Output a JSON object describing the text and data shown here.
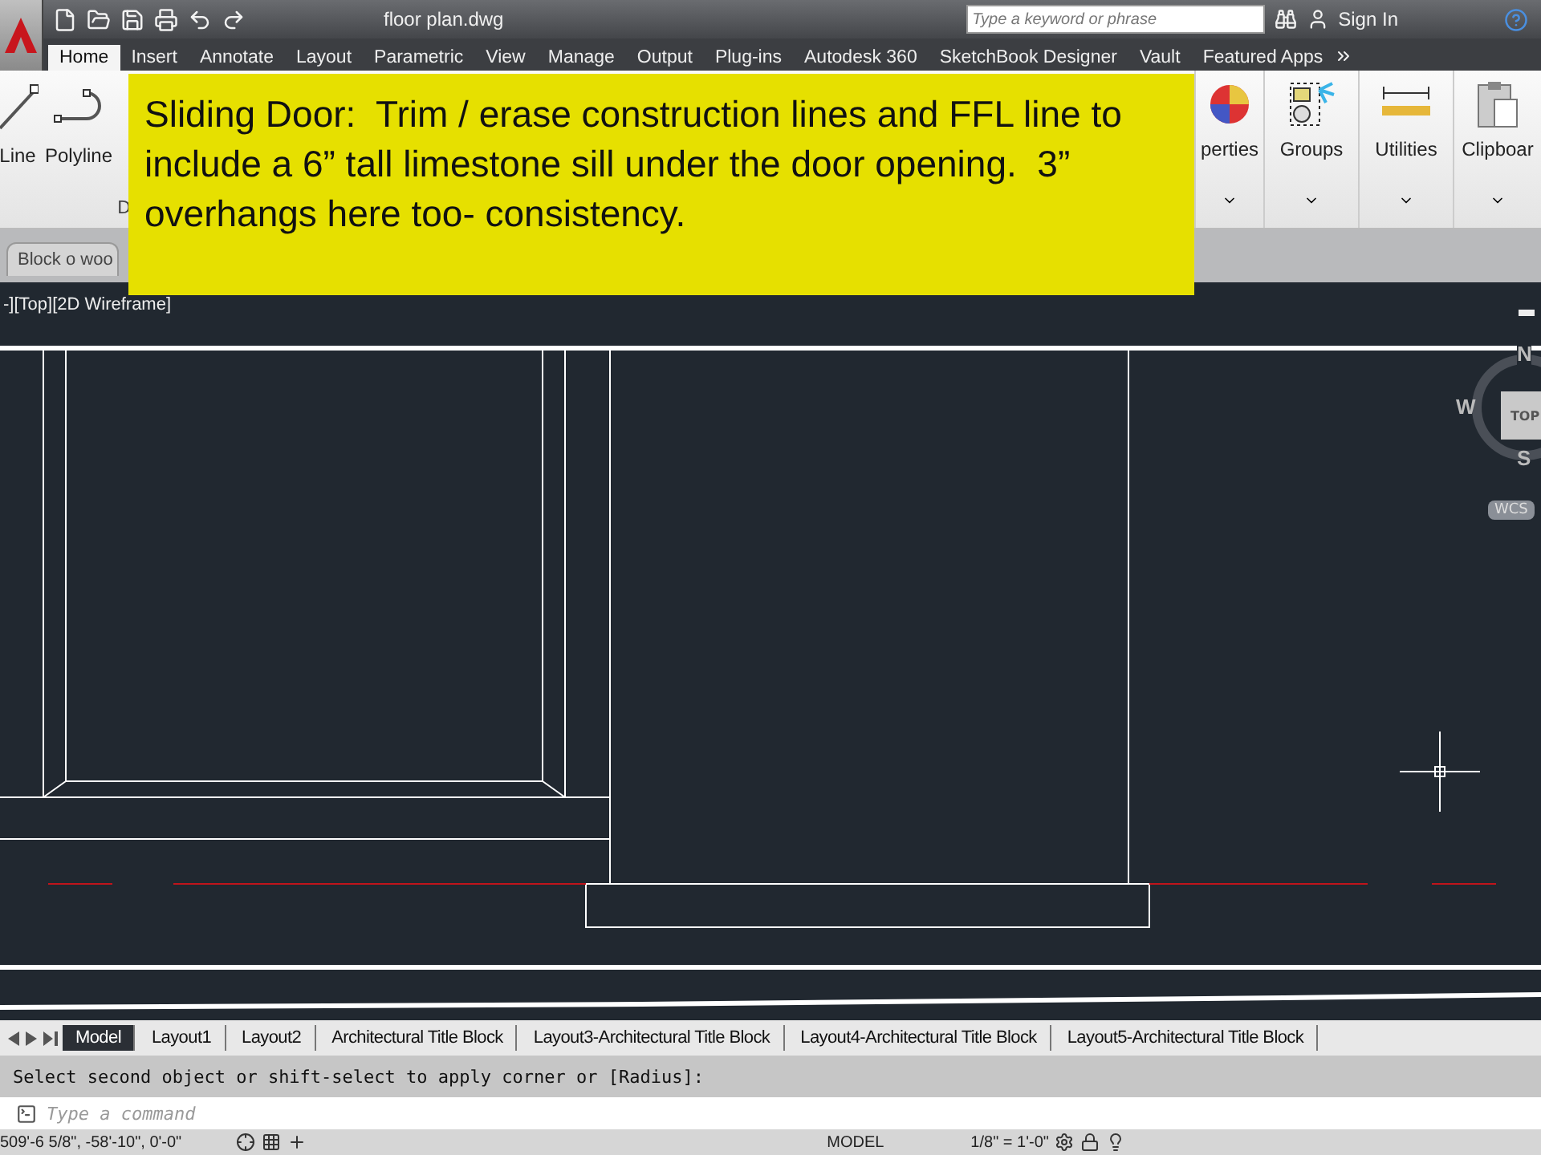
{
  "title_bar": {
    "title": "floor plan.dwg",
    "search": {
      "placeholder": "Type a keyword or phrase"
    },
    "sign_in": "Sign In"
  },
  "ribbon_tabs": [
    {
      "label": "Home",
      "selected": true
    },
    {
      "label": "Insert",
      "selected": false
    },
    {
      "label": "Annotate",
      "selected": false
    },
    {
      "label": "Layout",
      "selected": false
    },
    {
      "label": "Parametric",
      "selected": false
    },
    {
      "label": "View",
      "selected": false
    },
    {
      "label": "Manage",
      "selected": false
    },
    {
      "label": "Output",
      "selected": false
    },
    {
      "label": "Plug-ins",
      "selected": false
    },
    {
      "label": "Autodesk 360",
      "selected": false
    },
    {
      "label": "SketchBook Designer",
      "selected": false
    },
    {
      "label": "Vault",
      "selected": false
    },
    {
      "label": "Featured Apps",
      "selected": false
    }
  ],
  "ribbon_tools_left": [
    {
      "label": "Line",
      "kind": "line"
    },
    {
      "label": "Polyline",
      "kind": "polyline"
    }
  ],
  "ribbon_panel_title": "D",
  "ribbon_tools_right": [
    {
      "label": "perties",
      "kind": "properties"
    },
    {
      "label": "Groups",
      "kind": "groups"
    },
    {
      "label": "Utilities",
      "kind": "utilities"
    },
    {
      "label": "Clipboar",
      "kind": "clipboard"
    }
  ],
  "file_tab": {
    "label": "Block o woo"
  },
  "callout": {
    "text": "Sliding Door:  Trim / erase construction lines and FFL line to include a 6” tall limestone sill under the door opening.  3” overhangs here too- consistency."
  },
  "viewport": {
    "label": "-][Top][2D Wireframe]",
    "viewcube": {
      "north": "N",
      "west": "W",
      "south": "S",
      "face": "TOP",
      "ucs": "WCS"
    }
  },
  "layout_tabs": [
    {
      "label": "Model",
      "selected": true
    },
    {
      "label": "Layout1",
      "selected": false
    },
    {
      "label": "Layout2",
      "selected": false
    },
    {
      "label": "Architectural Title Block",
      "selected": false
    },
    {
      "label": "Layout3-Architectural Title Block",
      "selected": false
    },
    {
      "label": "Layout4-Architectural Title Block",
      "selected": false
    },
    {
      "label": "Layout5-Architectural Title Block",
      "selected": false
    }
  ],
  "command": {
    "history": "Select second object or shift-select to apply corner or [Radius]:",
    "placeholder": "Type a command"
  },
  "status_bar": {
    "coordinates": "509'-6 5/8\", -58'-10\", 0'-0\"",
    "space": "MODEL",
    "scale": "1/8\" = 1'-0\""
  }
}
